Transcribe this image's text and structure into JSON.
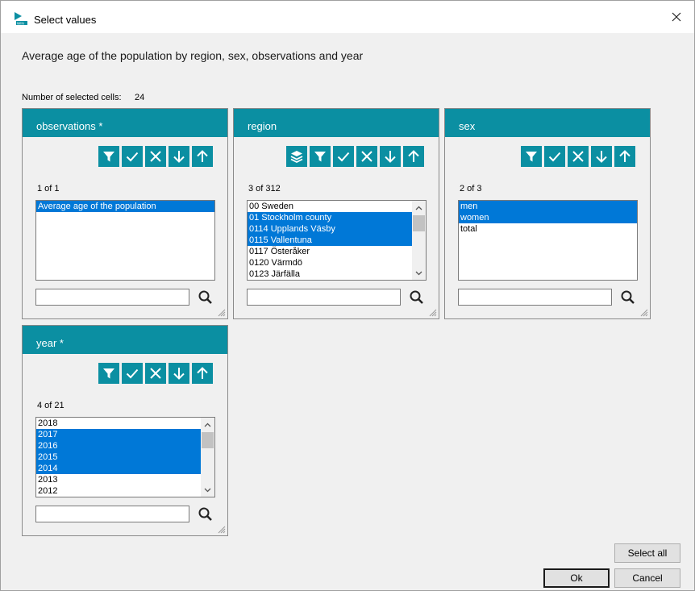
{
  "window": {
    "title": "Select values",
    "close_glyph": "✕"
  },
  "heading": "Average age of the population by region, sex, observations and year",
  "selected_cells": {
    "label": "Number of selected cells:",
    "value": "24"
  },
  "panels": {
    "observations": {
      "title": "observations *",
      "count": "1 of 1",
      "tools": [
        "filter-icon",
        "check-icon",
        "x-icon",
        "arrow-down-icon",
        "arrow-up-icon"
      ],
      "items": [
        {
          "text": "Average age of  the population",
          "selected": true
        }
      ],
      "search_value": ""
    },
    "region": {
      "title": "region",
      "count": "3 of 312",
      "tools": [
        "layers-icon",
        "filter-icon",
        "check-icon",
        "x-icon",
        "arrow-down-icon",
        "arrow-up-icon"
      ],
      "items": [
        {
          "text": "00 Sweden",
          "selected": false
        },
        {
          "text": "01 Stockholm county",
          "selected": true
        },
        {
          "text": "0114 Upplands Väsby",
          "selected": true
        },
        {
          "text": "0115 Vallentuna",
          "selected": true
        },
        {
          "text": "0117 Österåker",
          "selected": false
        },
        {
          "text": "0120 Värmdö",
          "selected": false
        },
        {
          "text": "0123 Järfälla",
          "selected": false
        }
      ],
      "search_value": ""
    },
    "sex": {
      "title": "sex",
      "count": "2 of 3",
      "tools": [
        "filter-icon",
        "check-icon",
        "x-icon",
        "arrow-down-icon",
        "arrow-up-icon"
      ],
      "items": [
        {
          "text": "men",
          "selected": true
        },
        {
          "text": "women",
          "selected": true
        },
        {
          "text": "total",
          "selected": false
        }
      ],
      "search_value": ""
    },
    "year": {
      "title": "year *",
      "count": "4 of 21",
      "tools": [
        "filter-icon",
        "check-icon",
        "x-icon",
        "arrow-down-icon",
        "arrow-up-icon"
      ],
      "items": [
        {
          "text": "2018",
          "selected": false
        },
        {
          "text": "2017",
          "selected": true
        },
        {
          "text": "2016",
          "selected": true
        },
        {
          "text": "2015",
          "selected": true
        },
        {
          "text": "2014",
          "selected": true
        },
        {
          "text": "2013",
          "selected": false
        },
        {
          "text": "2012",
          "selected": false
        }
      ],
      "search_value": ""
    }
  },
  "buttons": {
    "select_all": "Select all",
    "ok": "Ok",
    "cancel": "Cancel"
  },
  "colors": {
    "accent": "#0b8fa2",
    "selection": "#0078d7",
    "background": "#f0f0f0"
  }
}
